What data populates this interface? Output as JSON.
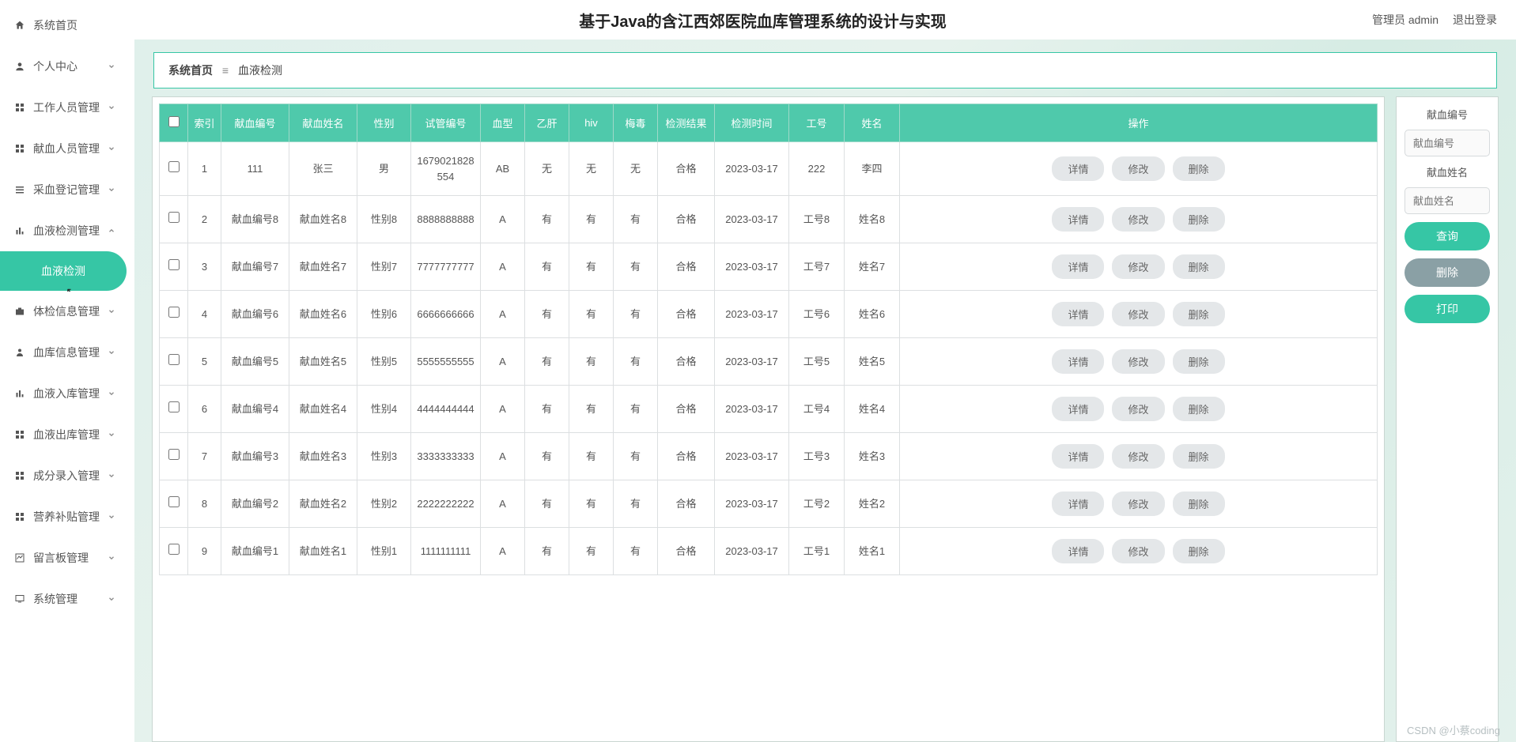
{
  "topbar": {
    "title": "基于Java的含江西郊医院血库管理系统的设计与实现",
    "user_label": "管理员 admin",
    "logout_label": "退出登录"
  },
  "breadcrumb": {
    "home": "系统首页",
    "sep": "≡",
    "current": "血液检测"
  },
  "sidebar": {
    "items": [
      {
        "label": "系统首页",
        "icon": "home-icon",
        "expandable": false
      },
      {
        "label": "个人中心",
        "icon": "user-icon",
        "expandable": true
      },
      {
        "label": "工作人员管理",
        "icon": "grid-icon",
        "expandable": true
      },
      {
        "label": "献血人员管理",
        "icon": "grid-icon",
        "expandable": true
      },
      {
        "label": "采血登记管理",
        "icon": "list-icon",
        "expandable": true
      },
      {
        "label": "血液检测管理",
        "icon": "bars-icon",
        "expandable": true,
        "open": true,
        "children": [
          {
            "label": "血液检测"
          }
        ]
      },
      {
        "label": "体检信息管理",
        "icon": "briefcase-icon",
        "expandable": true
      },
      {
        "label": "血库信息管理",
        "icon": "person-icon",
        "expandable": true
      },
      {
        "label": "血液入库管理",
        "icon": "bars-icon",
        "expandable": true
      },
      {
        "label": "血液出库管理",
        "icon": "grid-icon",
        "expandable": true
      },
      {
        "label": "成分录入管理",
        "icon": "grid-icon",
        "expandable": true
      },
      {
        "label": "营养补贴管理",
        "icon": "grid-icon",
        "expandable": true
      },
      {
        "label": "留言板管理",
        "icon": "chart-icon",
        "expandable": true
      },
      {
        "label": "系统管理",
        "icon": "monitor-icon",
        "expandable": true
      }
    ]
  },
  "table": {
    "columns": [
      "",
      "索引",
      "献血编号",
      "献血姓名",
      "性别",
      "试管编号",
      "血型",
      "乙肝",
      "hiv",
      "梅毒",
      "检测结果",
      "检测时间",
      "工号",
      "姓名",
      "操作"
    ],
    "actions": {
      "detail": "详情",
      "edit": "修改",
      "del": "删除"
    },
    "rows": [
      {
        "idx": "1",
        "code": "111",
        "name": "张三",
        "gender": "男",
        "tube": "1679021828554",
        "blood": "AB",
        "hbv": "无",
        "hiv": "无",
        "syph": "无",
        "result": "合格",
        "time": "2023-03-17",
        "staff_no": "222",
        "staff_name": "李四"
      },
      {
        "idx": "2",
        "code": "献血编号8",
        "name": "献血姓名8",
        "gender": "性别8",
        "tube": "8888888888",
        "blood": "A",
        "hbv": "有",
        "hiv": "有",
        "syph": "有",
        "result": "合格",
        "time": "2023-03-17",
        "staff_no": "工号8",
        "staff_name": "姓名8"
      },
      {
        "idx": "3",
        "code": "献血编号7",
        "name": "献血姓名7",
        "gender": "性别7",
        "tube": "7777777777",
        "blood": "A",
        "hbv": "有",
        "hiv": "有",
        "syph": "有",
        "result": "合格",
        "time": "2023-03-17",
        "staff_no": "工号7",
        "staff_name": "姓名7"
      },
      {
        "idx": "4",
        "code": "献血编号6",
        "name": "献血姓名6",
        "gender": "性别6",
        "tube": "6666666666",
        "blood": "A",
        "hbv": "有",
        "hiv": "有",
        "syph": "有",
        "result": "合格",
        "time": "2023-03-17",
        "staff_no": "工号6",
        "staff_name": "姓名6"
      },
      {
        "idx": "5",
        "code": "献血编号5",
        "name": "献血姓名5",
        "gender": "性别5",
        "tube": "5555555555",
        "blood": "A",
        "hbv": "有",
        "hiv": "有",
        "syph": "有",
        "result": "合格",
        "time": "2023-03-17",
        "staff_no": "工号5",
        "staff_name": "姓名5"
      },
      {
        "idx": "6",
        "code": "献血编号4",
        "name": "献血姓名4",
        "gender": "性别4",
        "tube": "4444444444",
        "blood": "A",
        "hbv": "有",
        "hiv": "有",
        "syph": "有",
        "result": "合格",
        "time": "2023-03-17",
        "staff_no": "工号4",
        "staff_name": "姓名4"
      },
      {
        "idx": "7",
        "code": "献血编号3",
        "name": "献血姓名3",
        "gender": "性别3",
        "tube": "3333333333",
        "blood": "A",
        "hbv": "有",
        "hiv": "有",
        "syph": "有",
        "result": "合格",
        "time": "2023-03-17",
        "staff_no": "工号3",
        "staff_name": "姓名3"
      },
      {
        "idx": "8",
        "code": "献血编号2",
        "name": "献血姓名2",
        "gender": "性别2",
        "tube": "2222222222",
        "blood": "A",
        "hbv": "有",
        "hiv": "有",
        "syph": "有",
        "result": "合格",
        "time": "2023-03-17",
        "staff_no": "工号2",
        "staff_name": "姓名2"
      },
      {
        "idx": "9",
        "code": "献血编号1",
        "name": "献血姓名1",
        "gender": "性别1",
        "tube": "1111111111",
        "blood": "A",
        "hbv": "有",
        "hiv": "有",
        "syph": "有",
        "result": "合格",
        "time": "2023-03-17",
        "staff_no": "工号1",
        "staff_name": "姓名1"
      }
    ]
  },
  "filter": {
    "label_code": "献血编号",
    "placeholder_code": "献血编号",
    "label_name": "献血姓名",
    "placeholder_name": "献血姓名",
    "search": "查询",
    "del": "删除",
    "print": "打印"
  },
  "watermark": "CSDN @小蔡coding"
}
